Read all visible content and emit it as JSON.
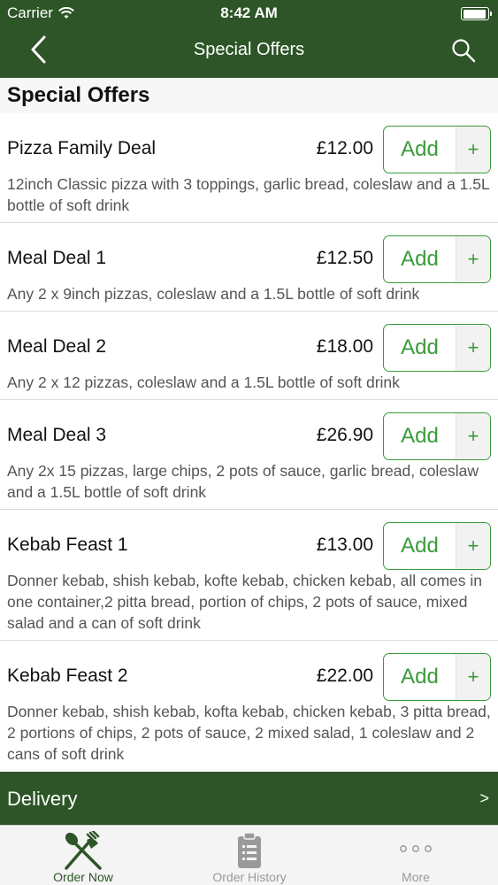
{
  "status": {
    "carrier": "Carrier",
    "time": "8:42 AM"
  },
  "nav": {
    "title": "Special Offers"
  },
  "section": {
    "title": "Special Offers"
  },
  "items": [
    {
      "name": "Pizza Family Deal",
      "price": "£12.00",
      "description": "12inch Classic pizza with 3 toppings, garlic bread, coleslaw and a 1.5L bottle of soft drink",
      "add_label": "Add",
      "plus_label": "+"
    },
    {
      "name": "Meal Deal 1",
      "price": "£12.50",
      "description": "Any 2 x 9inch pizzas, coleslaw and a 1.5L bottle of soft drink",
      "add_label": "Add",
      "plus_label": "+"
    },
    {
      "name": "Meal Deal 2",
      "price": "£18.00",
      "description": "Any 2 x 12 pizzas, coleslaw and a 1.5L bottle of soft drink",
      "add_label": "Add",
      "plus_label": "+"
    },
    {
      "name": "Meal Deal 3",
      "price": "£26.90",
      "description": "Any 2x 15 pizzas, large chips, 2 pots of sauce, garlic bread, coleslaw and a 1.5L bottle of soft drink",
      "add_label": "Add",
      "plus_label": "+"
    },
    {
      "name": "Kebab Feast 1",
      "price": "£13.00",
      "description": "Donner kebab, shish kebab, kofte kebab, chicken kebab, all comes in one container,2 pitta bread, portion of chips, 2 pots of sauce, mixed salad and a can of soft drink",
      "add_label": "Add",
      "plus_label": "+"
    },
    {
      "name": "Kebab Feast 2",
      "price": "£22.00",
      "description": "Donner kebab, shish kebab, kofta kebab, chicken kebab, 3 pitta bread, 2 portions of chips, 2 pots of sauce, 2 mixed salad, 1 coleslaw and 2 cans of soft drink",
      "add_label": "Add",
      "plus_label": "+"
    }
  ],
  "delivery": {
    "label": "Delivery",
    "chevron": ">"
  },
  "tabs": [
    {
      "label": "Order Now",
      "icon": "fork-knife-icon",
      "active": true
    },
    {
      "label": "Order History",
      "icon": "clipboard-icon",
      "active": false
    },
    {
      "label": "More",
      "icon": "more-dots-icon",
      "active": false
    }
  ],
  "colors": {
    "brand_green": "#2d5527",
    "accent_green": "#3a9b3a",
    "inactive_gray": "#9a9a9a"
  }
}
